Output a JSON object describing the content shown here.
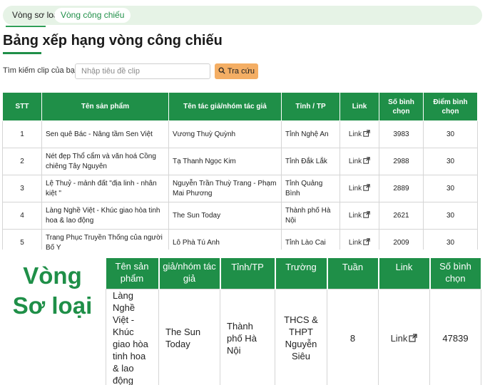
{
  "tabs": [
    "Vòng sơ loại",
    "Vòng công chiếu"
  ],
  "title": "Bảng xếp hạng vòng công chiếu",
  "search": {
    "label": "Tìm kiếm clip của bạn",
    "placeholder": "Nhập tiêu đề clip",
    "button": "Tra cứu"
  },
  "table": {
    "headers": [
      "STT",
      "Tên sản phẩm",
      "Tên tác giả/nhóm tác giả",
      "Tỉnh / TP",
      "Link",
      "Số bình chọn",
      "Điểm bình chọn"
    ],
    "rows": [
      [
        "1",
        "Sen quê Bác - Nâng tầm Sen Việt",
        "Vương Thuỳ Quỳnh",
        "Tỉnh Nghệ An",
        "Link",
        "3983",
        "30"
      ],
      [
        "2",
        "Nét đẹp Thổ cẩm và văn hoá Cồng chiêng Tây Nguyên",
        "Tạ Thanh Ngọc Kim",
        "Tỉnh Đắk Lắk",
        "Link",
        "2988",
        "30"
      ],
      [
        "3",
        "Lệ Thuỷ - mảnh đất \"địa linh - nhân kiệt \"",
        "Nguyễn Trần Thuỳ Trang - Phạm Mai Phương",
        "Tỉnh Quảng Bình",
        "Link",
        "2889",
        "30"
      ],
      [
        "4",
        "Làng Nghề Việt - Khúc giao hòa tinh hoa & lao động",
        "The Sun Today",
        "Thành phố Hà Nội",
        "Link",
        "2621",
        "30"
      ],
      [
        "5",
        "Trang Phục Truyền Thống của người Bố Y",
        "Lô Phà Tú Anh",
        "Tỉnh Lào Cai",
        "Link",
        "2009",
        "30"
      ]
    ]
  },
  "overlay": {
    "label": "Vòng Sơ loại",
    "headers": [
      "Tên sản phẩm",
      "Tên tác giả/nhóm tác giả",
      "Tỉnh/TP",
      "Trường",
      "Tuần",
      "Link",
      "Số bình chọn"
    ],
    "row": [
      "Làng Nghề Việt - Khúc giao hòa tinh hoa & lao động",
      "The Sun Today",
      "Thành phố Hà Nội",
      "THCS & THPT Nguyễn Siêu",
      "8",
      "Link",
      "47839"
    ]
  },
  "colors": {
    "accent": "#1f8f48",
    "button": "#f4ae64",
    "tabbar": "#e6f3e6"
  },
  "icons": {
    "search": "search-icon",
    "external": "external-link-icon"
  }
}
